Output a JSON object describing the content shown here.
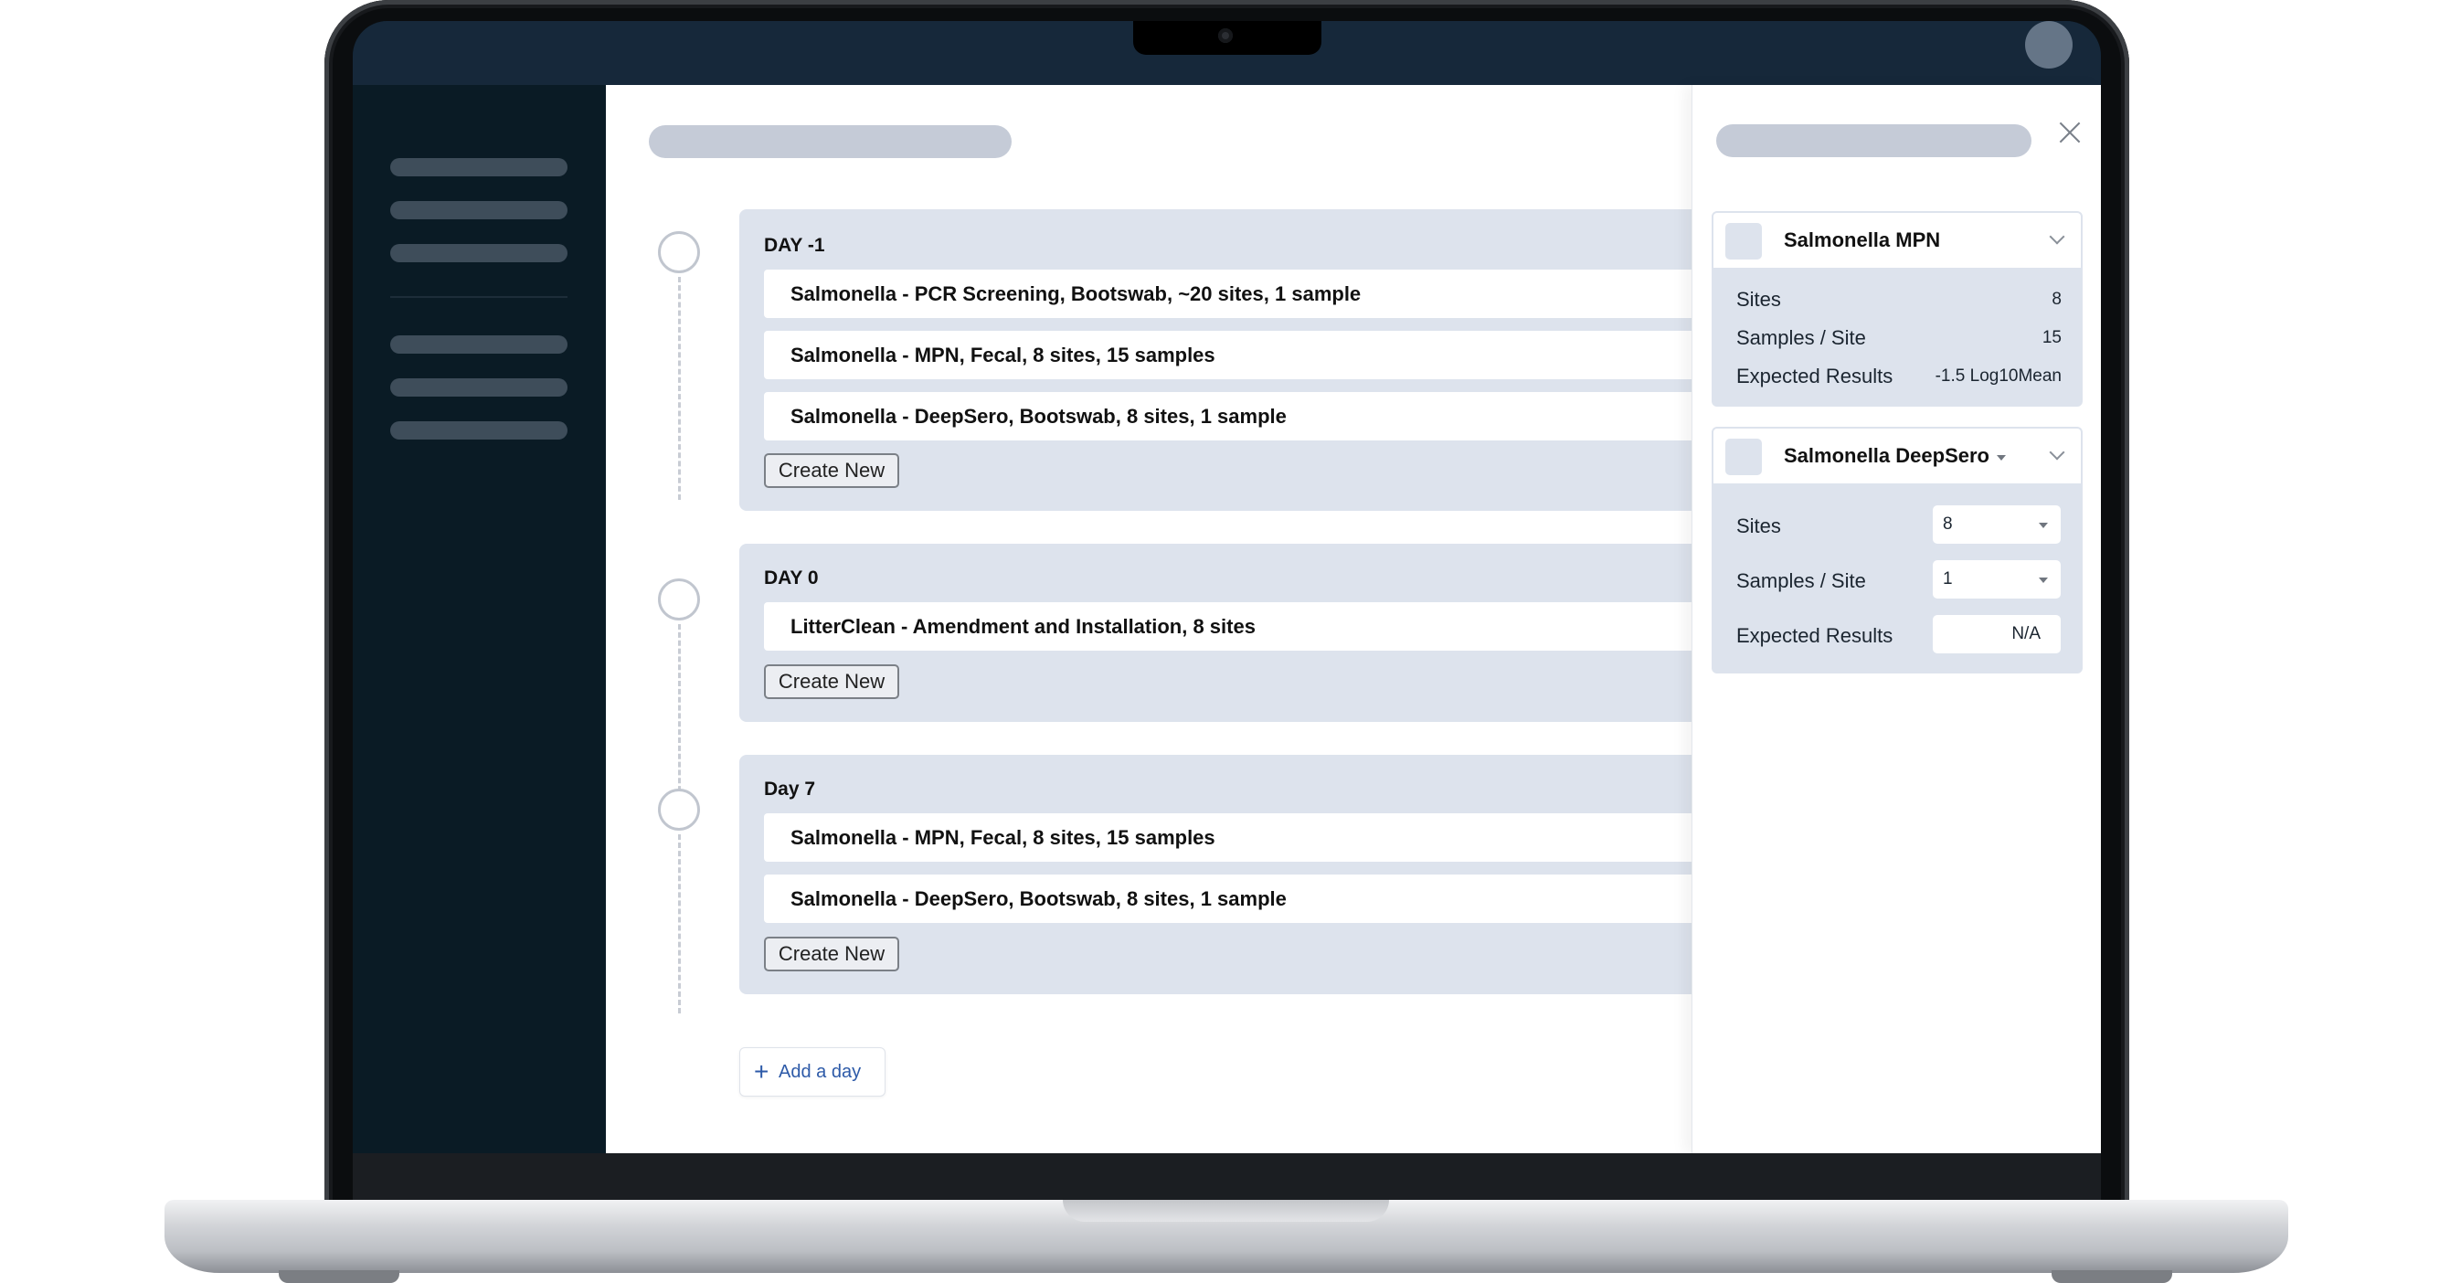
{
  "timeline": {
    "days": [
      {
        "title": "DAY -1",
        "tasks": [
          "Salmonella - PCR Screening, Bootswab, ~20 sites, 1 sample",
          "Salmonella - MPN, Fecal, 8 sites, 15 samples",
          "Salmonella - DeepSero, Bootswab, 8 sites, 1 sample"
        ],
        "create_label": "Create New"
      },
      {
        "title": "DAY 0",
        "tasks": [
          "LitterClean - Amendment and Installation, 8 sites"
        ],
        "create_label": "Create New"
      },
      {
        "title": "Day 7",
        "tasks": [
          "Salmonella - MPN, Fecal, 8 sites, 15 samples",
          "Salmonella - DeepSero, Bootswab, 8 sites, 1 sample"
        ],
        "create_label": "Create New"
      }
    ],
    "add_day_label": "Add a day"
  },
  "panel": {
    "sections": [
      {
        "title": "Salmonella MPN",
        "sites_label": "Sites",
        "sites_value": "8",
        "samples_label": "Samples / Site",
        "samples_value": "15",
        "results_label": "Expected Results",
        "results_value": "-1.5 Log10Mean"
      },
      {
        "title": "Salmonella DeepSero",
        "sites_label": "Sites",
        "sites_value": "8",
        "samples_label": "Samples / Site",
        "samples_value": "1",
        "results_label": "Expected Results",
        "results_value": "N/A"
      }
    ]
  },
  "icons": {
    "close": "close-icon",
    "add": "plus-icon",
    "expand": "chevron-down-icon",
    "dropdown": "caret-down-icon"
  },
  "colors": {
    "sidebar": "#0a1b25",
    "topbar": "#16283a",
    "card": "#dde3ed",
    "skeleton": "#c5cbd7",
    "link": "#2d5aa8"
  }
}
